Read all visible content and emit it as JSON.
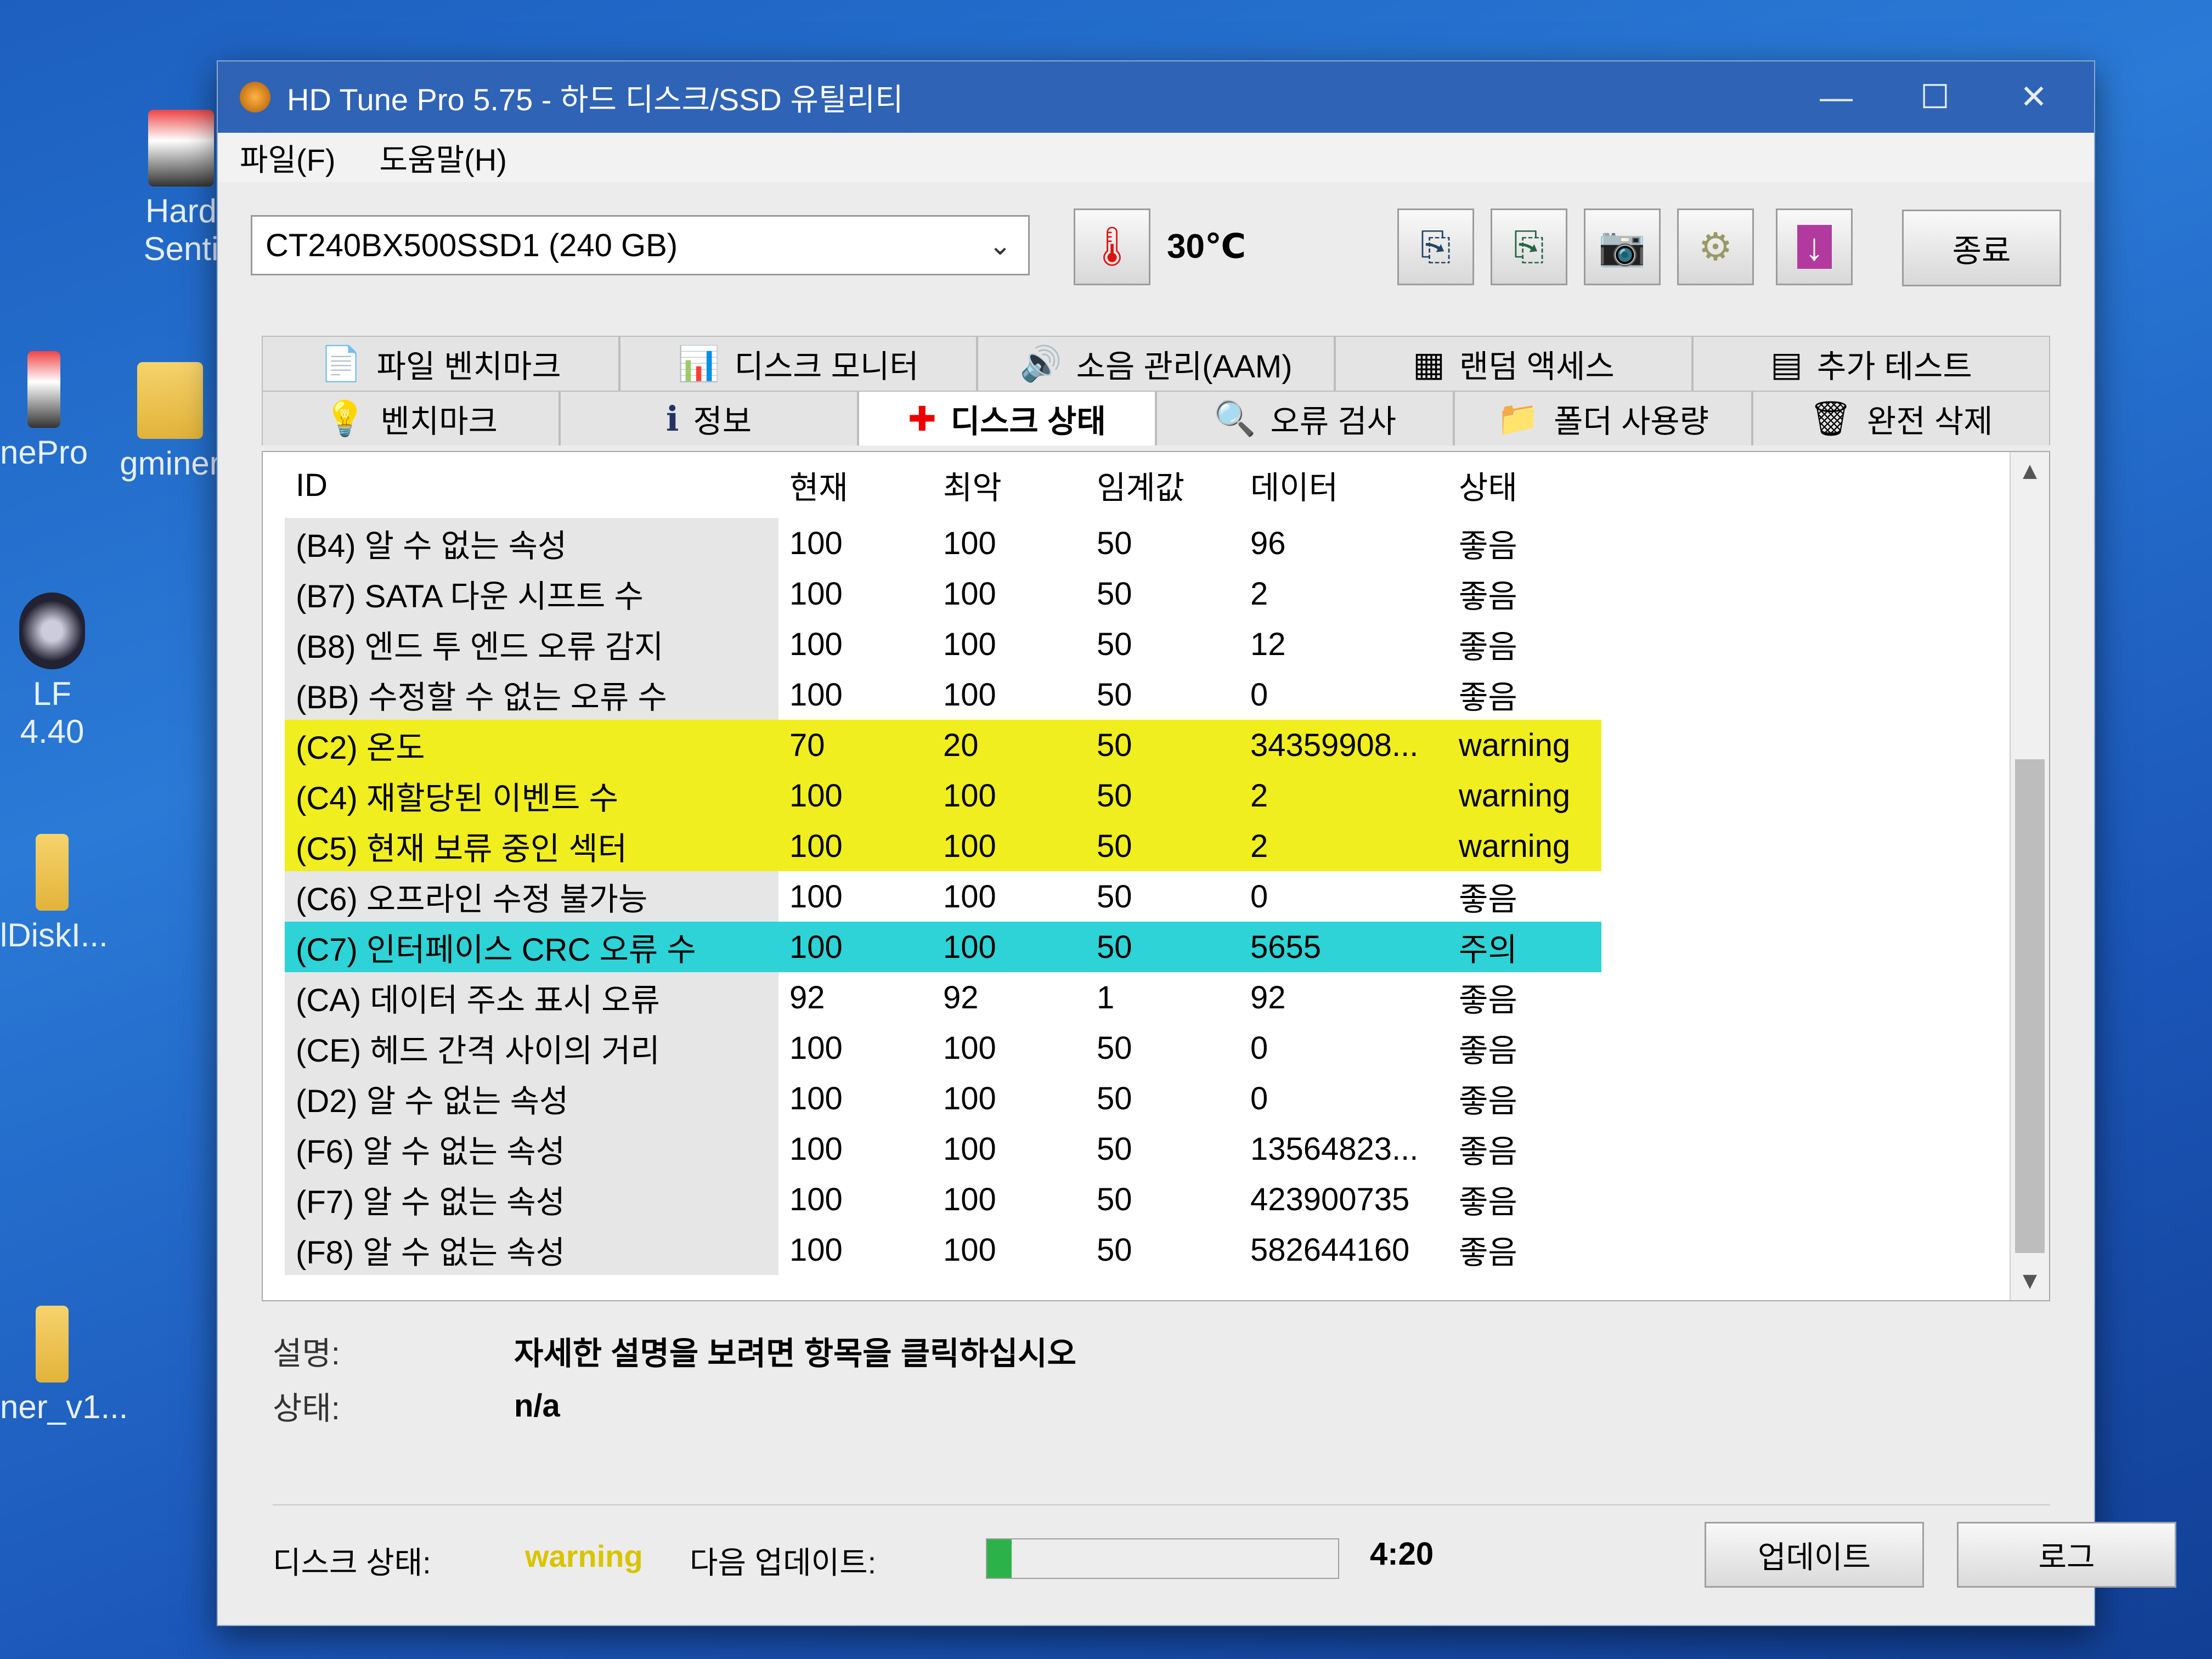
{
  "desktop": {
    "icons": [
      {
        "label": "Hard Senti",
        "icon": "app-icon"
      },
      {
        "label": "nePro",
        "icon": "app-icon"
      },
      {
        "label": "gminer",
        "icon": "folder-icon"
      },
      {
        "label": "LF 4.40",
        "icon": "disk-icon"
      },
      {
        "label": "lDiskI...",
        "icon": "folder-icon"
      },
      {
        "label": "ner_v1...",
        "icon": "folder-icon"
      }
    ]
  },
  "window": {
    "title": "HD Tune Pro 5.75 - 하드 디스크/SSD 유틸리티",
    "controls": {
      "minimize": "—",
      "maximize": "☐",
      "close": "✕"
    }
  },
  "menu": {
    "file": "파일(F)",
    "help": "도움말(H)"
  },
  "toolbar": {
    "drive": "CT240BX500SSD1 (240 GB)",
    "temperature": "30℃",
    "exit_label": "종료"
  },
  "tabs": {
    "row1": [
      {
        "label": "파일 벤치마크",
        "icon": "file-benchmark-icon"
      },
      {
        "label": "디스크 모니터",
        "icon": "disk-monitor-icon"
      },
      {
        "label": "소음 관리(AAM)",
        "icon": "speaker-icon"
      },
      {
        "label": "랜덤 액세스",
        "icon": "random-access-icon"
      },
      {
        "label": "추가 테스트",
        "icon": "extra-tests-icon"
      }
    ],
    "row2": [
      {
        "label": "벤치마크",
        "icon": "benchmark-icon"
      },
      {
        "label": "정보",
        "icon": "info-icon"
      },
      {
        "label": "디스크 상태",
        "icon": "health-cross-icon",
        "active": true
      },
      {
        "label": "오류 검사",
        "icon": "magnifier-icon"
      },
      {
        "label": "폴더 사용량",
        "icon": "folder-icon"
      },
      {
        "label": "완전 삭제",
        "icon": "trash-icon"
      }
    ]
  },
  "smart_table": {
    "headers": {
      "id": "ID",
      "current": "현재",
      "worst": "최악",
      "threshold": "임계값",
      "data": "데이터",
      "status": "상태"
    },
    "rows": [
      {
        "id": "(B4) 알 수 없는 속성",
        "current": "100",
        "worst": "100",
        "threshold": "50",
        "data": "96",
        "status": "좋음",
        "level": "ok"
      },
      {
        "id": "(B7) SATA 다운 시프트 수",
        "current": "100",
        "worst": "100",
        "threshold": "50",
        "data": "2",
        "status": "좋음",
        "level": "ok"
      },
      {
        "id": "(B8) 엔드 투 엔드 오류 감지",
        "current": "100",
        "worst": "100",
        "threshold": "50",
        "data": "12",
        "status": "좋음",
        "level": "ok"
      },
      {
        "id": "(BB) 수정할 수 없는 오류 수",
        "current": "100",
        "worst": "100",
        "threshold": "50",
        "data": "0",
        "status": "좋음",
        "level": "ok"
      },
      {
        "id": "(C2) 온도",
        "current": "70",
        "worst": "20",
        "threshold": "50",
        "data": "34359908...",
        "status": "warning",
        "level": "warn"
      },
      {
        "id": "(C4) 재할당된 이벤트 수",
        "current": "100",
        "worst": "100",
        "threshold": "50",
        "data": "2",
        "status": "warning",
        "level": "warn"
      },
      {
        "id": "(C5) 현재 보류 중인 섹터",
        "current": "100",
        "worst": "100",
        "threshold": "50",
        "data": "2",
        "status": "warning",
        "level": "warn"
      },
      {
        "id": "(C6) 오프라인 수정 불가능",
        "current": "100",
        "worst": "100",
        "threshold": "50",
        "data": "0",
        "status": "좋음",
        "level": "ok"
      },
      {
        "id": "(C7) 인터페이스 CRC 오류 수",
        "current": "100",
        "worst": "100",
        "threshold": "50",
        "data": "5655",
        "status": "주의",
        "level": "caution"
      },
      {
        "id": "(CA) 데이터 주소 표시 오류",
        "current": "92",
        "worst": "92",
        "threshold": "1",
        "data": "92",
        "status": "좋음",
        "level": "ok"
      },
      {
        "id": "(CE) 헤드 간격 사이의 거리",
        "current": "100",
        "worst": "100",
        "threshold": "50",
        "data": "0",
        "status": "좋음",
        "level": "ok"
      },
      {
        "id": "(D2) 알 수 없는 속성",
        "current": "100",
        "worst": "100",
        "threshold": "50",
        "data": "0",
        "status": "좋음",
        "level": "ok"
      },
      {
        "id": "(F6) 알 수 없는 속성",
        "current": "100",
        "worst": "100",
        "threshold": "50",
        "data": "13564823...",
        "status": "좋음",
        "level": "ok"
      },
      {
        "id": "(F7) 알 수 없는 속성",
        "current": "100",
        "worst": "100",
        "threshold": "50",
        "data": "423900735",
        "status": "좋음",
        "level": "ok"
      },
      {
        "id": "(F8) 알 수 없는 속성",
        "current": "100",
        "worst": "100",
        "threshold": "50",
        "data": "582644160",
        "status": "좋음",
        "level": "ok"
      }
    ],
    "colors": {
      "warn": "#f0ee1e",
      "caution": "#2dd3d6"
    }
  },
  "description": {
    "desc_label": "설명:",
    "desc_value": "자세한 설명을 보려면 항목을 클릭하십시오",
    "status_label": "상태:",
    "status_value": "n/a"
  },
  "statusbar": {
    "disk_status_label": "디스크 상태:",
    "disk_status_value": "warning",
    "next_update_label": "다음 업데이트:",
    "progress": 0.07,
    "countdown": "4:20",
    "update_button": "업데이트",
    "log_button": "로그"
  }
}
